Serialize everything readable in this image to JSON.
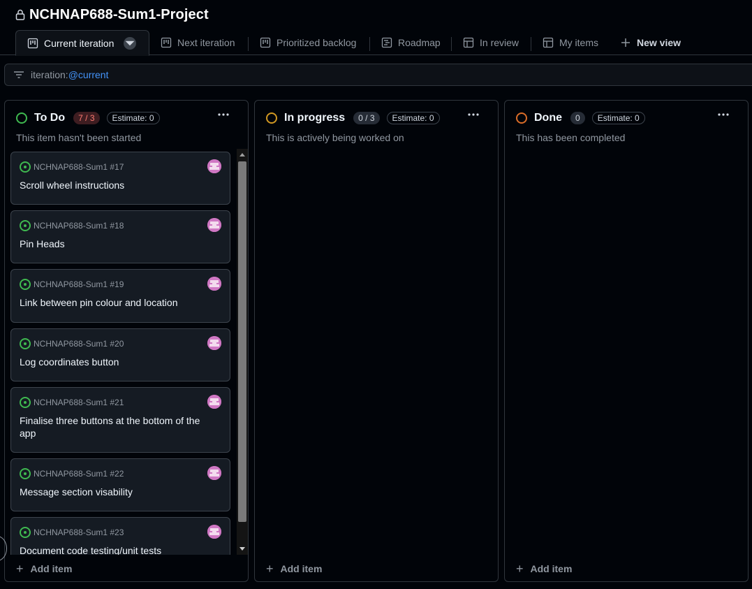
{
  "project": {
    "title": "NCHNAP688-Sum1-Project",
    "icon": "lock-icon"
  },
  "tabs": [
    {
      "label": "Current iteration",
      "icon": "board-icon",
      "active": true
    },
    {
      "label": "Next iteration",
      "icon": "board-icon"
    },
    {
      "label": "Prioritized backlog",
      "icon": "board-icon"
    },
    {
      "label": "Roadmap",
      "icon": "roadmap-icon"
    },
    {
      "label": "In review",
      "icon": "table-icon"
    },
    {
      "label": "My items",
      "icon": "table-icon"
    },
    {
      "label": "New view",
      "icon": "plus-icon"
    }
  ],
  "filter": {
    "key": "iteration:",
    "value": "@current",
    "icon": "filter-icon"
  },
  "columns": [
    {
      "name": "To Do",
      "count": "7 / 3",
      "estimate": "Estimate: 0",
      "description": "This item hasn't been started",
      "status_color": "#3fb950",
      "add_label": "Add item",
      "cards": [
        {
          "ref": "NCHNAP688-Sum1 #17",
          "title": "Scroll wheel instructions"
        },
        {
          "ref": "NCHNAP688-Sum1 #18",
          "title": "Pin Heads"
        },
        {
          "ref": "NCHNAP688-Sum1 #19",
          "title": "Link between pin colour and location"
        },
        {
          "ref": "NCHNAP688-Sum1 #20",
          "title": "Log coordinates button"
        },
        {
          "ref": "NCHNAP688-Sum1 #21",
          "title": "Finalise three buttons at the bottom of the app"
        },
        {
          "ref": "NCHNAP688-Sum1 #22",
          "title": "Message section visability"
        },
        {
          "ref": "NCHNAP688-Sum1 #23",
          "title": "Document code testing/unit tests"
        }
      ]
    },
    {
      "name": "In progress",
      "count": "0 / 3",
      "estimate": "Estimate: 0",
      "description": "This is actively being worked on",
      "status_color": "#d29922",
      "add_label": "Add item"
    },
    {
      "name": "Done",
      "count": "0",
      "estimate": "Estimate: 0",
      "description": "This has been completed",
      "status_color": "#db6d28",
      "add_label": "Add item"
    }
  ],
  "colors": {
    "background": "#010409",
    "card": "#151b23",
    "border": "#30363d",
    "accent": "#4493f8",
    "over_limit": "#ff7b72"
  }
}
